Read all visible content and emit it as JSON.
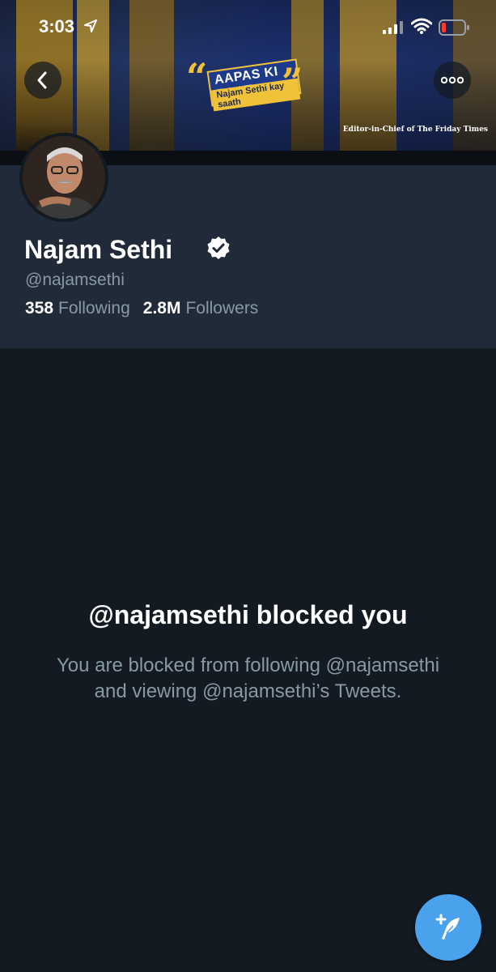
{
  "status_bar": {
    "time": "3:03"
  },
  "banner": {
    "logo_main": "AAPAS KI BAAT",
    "logo_sub": "Najam Sethi kay saath",
    "caption": "Editor-in-Chief of The Friday Times"
  },
  "header": {
    "back_icon": "chevron-left-icon",
    "more_icon": "ellipsis-icon"
  },
  "profile": {
    "name": "Najam Sethi",
    "handle": "@najamsethi",
    "following_count": "358",
    "following_label": "Following",
    "followers_count": "2.8M",
    "followers_label": "Followers"
  },
  "blocked": {
    "title": "@najamsethi blocked you",
    "description": "You are blocked from following @najamsethi and viewing @najamsethi’s Tweets."
  },
  "colors": {
    "accent": "#4aa1ec",
    "background": "#141a22",
    "card": "#202a38",
    "muted_text": "#8899a6"
  }
}
